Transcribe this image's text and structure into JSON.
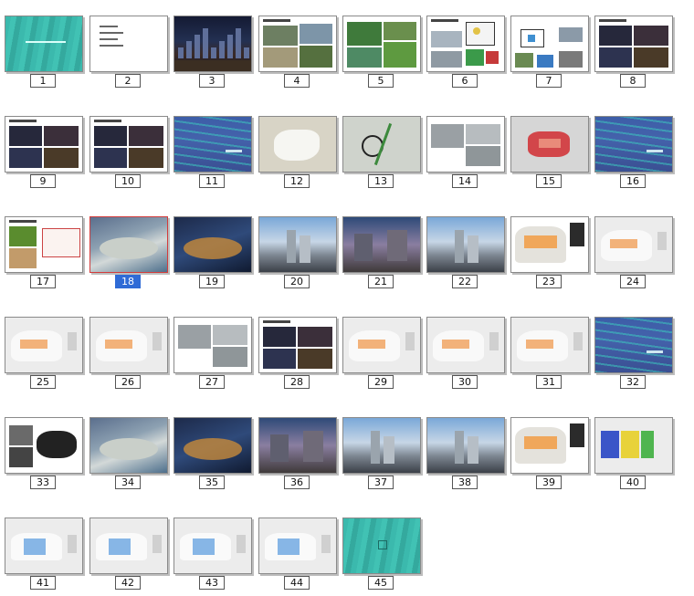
{
  "slide_sorter": {
    "selected_slide": "18",
    "slides": [
      {
        "number": "1",
        "style": "teal-title"
      },
      {
        "number": "2",
        "style": "text-bullets"
      },
      {
        "number": "3",
        "style": "night-city"
      },
      {
        "number": "4",
        "style": "photo-collage"
      },
      {
        "number": "5",
        "style": "green-collage"
      },
      {
        "number": "6",
        "style": "diagram-photos"
      },
      {
        "number": "7",
        "style": "diagram-map"
      },
      {
        "number": "8",
        "style": "night-collage"
      },
      {
        "number": "9",
        "style": "night-collage"
      },
      {
        "number": "10",
        "style": "night-collage"
      },
      {
        "number": "11",
        "style": "blue-wave"
      },
      {
        "number": "12",
        "style": "map-plain"
      },
      {
        "number": "13",
        "style": "map-route"
      },
      {
        "number": "14",
        "style": "grey-photos"
      },
      {
        "number": "15",
        "style": "red-map"
      },
      {
        "number": "16",
        "style": "blue-wave"
      },
      {
        "number": "17",
        "style": "green-plan"
      },
      {
        "number": "18",
        "style": "aerial-day"
      },
      {
        "number": "19",
        "style": "aerial-night"
      },
      {
        "number": "20",
        "style": "render-day"
      },
      {
        "number": "21",
        "style": "render-dusk"
      },
      {
        "number": "22",
        "style": "render-day"
      },
      {
        "number": "23",
        "style": "site-plan"
      },
      {
        "number": "24",
        "style": "site-plan-light"
      },
      {
        "number": "25",
        "style": "site-plan-light"
      },
      {
        "number": "26",
        "style": "site-plan-light"
      },
      {
        "number": "27",
        "style": "grey-photos"
      },
      {
        "number": "28",
        "style": "night-collage"
      },
      {
        "number": "29",
        "style": "site-plan-light"
      },
      {
        "number": "30",
        "style": "site-plan-light"
      },
      {
        "number": "31",
        "style": "site-plan-light"
      },
      {
        "number": "32",
        "style": "blue-wave"
      },
      {
        "number": "33",
        "style": "sketch-plan"
      },
      {
        "number": "34",
        "style": "aerial-day"
      },
      {
        "number": "35",
        "style": "aerial-night"
      },
      {
        "number": "36",
        "style": "render-dusk"
      },
      {
        "number": "37",
        "style": "render-day"
      },
      {
        "number": "38",
        "style": "render-day"
      },
      {
        "number": "39",
        "style": "site-plan"
      },
      {
        "number": "40",
        "style": "zoning-plan"
      },
      {
        "number": "41",
        "style": "zoning-plan-light"
      },
      {
        "number": "42",
        "style": "zoning-plan-light"
      },
      {
        "number": "43",
        "style": "zoning-plan-light"
      },
      {
        "number": "44",
        "style": "zoning-plan-light"
      },
      {
        "number": "45",
        "style": "teal-end"
      }
    ]
  }
}
